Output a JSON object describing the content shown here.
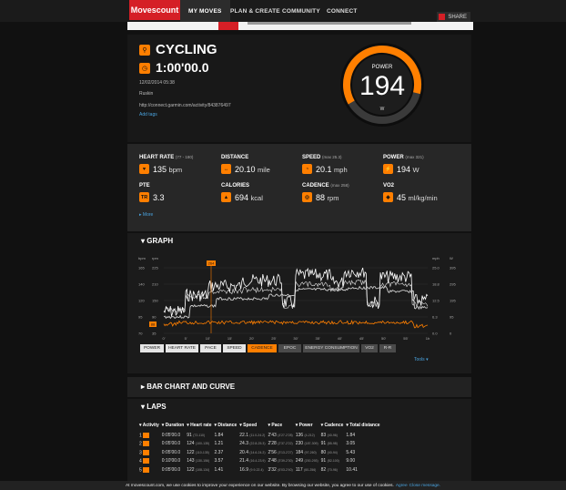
{
  "nav": {
    "logo": "Movescount",
    "items": [
      "MY MOVES",
      "PLAN & CREATE",
      "COMMUNITY",
      "CONNECT"
    ],
    "share": "SHARE"
  },
  "move": {
    "sport": "CYCLING",
    "duration": "1:00'00.0",
    "date": "12/02/2014 05:38",
    "location": "Ruskin",
    "link": "http://connect.garmin.com/activity/843876497",
    "add_tags": "Add tags"
  },
  "gauge": {
    "label": "POWER",
    "value": "194",
    "unit": "W",
    "fraction": 0.62,
    "accent": "#ff7f00"
  },
  "stats": [
    {
      "label": "HEART RATE",
      "sub": "(77 - 180)",
      "icon": "heart-icon",
      "glyph": "♥",
      "value": "135",
      "unit": "bpm"
    },
    {
      "label": "DISTANCE",
      "sub": "",
      "icon": "distance-icon",
      "glyph": "↔",
      "value": "20.10",
      "unit": "mile"
    },
    {
      "label": "SPEED",
      "sub": "(max 25.3)",
      "icon": "speed-icon",
      "glyph": "◔",
      "value": "20.1",
      "unit": "mph"
    },
    {
      "label": "POWER",
      "sub": "(max 321)",
      "icon": "power-icon",
      "glyph": "⚡",
      "value": "194",
      "unit": "W"
    },
    {
      "label": "PTE",
      "sub": "",
      "icon": "pte-icon",
      "glyph": "TR",
      "value": "3.3",
      "unit": ""
    },
    {
      "label": "CALORIES",
      "sub": "",
      "icon": "flame-icon",
      "glyph": "▲",
      "value": "694",
      "unit": "kcal"
    },
    {
      "label": "CADENCE",
      "sub": "(max 258)",
      "icon": "cadence-icon",
      "glyph": "◎",
      "value": "88",
      "unit": "rpm"
    },
    {
      "label": "VO2",
      "sub": "",
      "icon": "vo2-icon",
      "glyph": "◈",
      "value": "45",
      "unit": "ml/kg/min"
    }
  ],
  "more": "More",
  "graph": {
    "title": "GRAPH",
    "left_units": [
      "bpm",
      "rpm"
    ],
    "right_units": [
      "mph",
      "W"
    ],
    "hr_ticks": [
      "165",
      "140",
      "120",
      "95",
      "70"
    ],
    "cad_ticks": [
      "225",
      "210",
      "150",
      "90",
      "35"
    ],
    "mph_ticks": [
      "25.0",
      "18.8",
      "12.5",
      "6.3",
      "0.0"
    ],
    "w_ticks": [
      "395",
      "295",
      "195",
      "95",
      "0"
    ],
    "x_ticks": [
      "0'",
      "5'",
      "10'",
      "15'",
      "20'",
      "25'",
      "30'",
      "35'",
      "40'",
      "45'",
      "50'",
      "55'",
      "1h"
    ],
    "marker_label": "264",
    "left_badge": "88",
    "chips": [
      "POWER",
      "HEART RATE",
      "PACE",
      "SPEED",
      "CADENCE",
      "EPOC",
      "ENERGY CONSUMPTION",
      "VO2",
      "R-R"
    ],
    "tools": "Tools"
  },
  "bar_chart_title": "BAR CHART AND CURVE",
  "laps": {
    "title": "LAPS",
    "headers": [
      "Activity",
      "Duration",
      "Heart rate",
      "Distance",
      "Speed",
      "Pace",
      "Power",
      "Cadence",
      "Total distance"
    ],
    "rows": [
      {
        "n": "1",
        "duration": "0:05'00.0",
        "hr": "91",
        "hr_r": "(72-110)",
        "dist": "1.84",
        "spd": "22.1",
        "spd_r": "(11.0-24.2)",
        "pace": "2'43",
        "pace_r": "(4'27-2'28)",
        "pwr": "136",
        "pwr_r": "(4-212)",
        "cad": "83",
        "cad_r": "(40-96)",
        "total": "1.84"
      },
      {
        "n": "2",
        "duration": "0:05'00.0",
        "hr": "124",
        "hr_r": "(100-135)",
        "dist": "1.21",
        "spd": "24.3",
        "spd_r": "(22.8-25.3)",
        "pace": "2'28",
        "pace_r": "(2'37-2'22)",
        "pwr": "230",
        "pwr_r": "(187-309)",
        "cad": "91",
        "cad_r": "(85-98)",
        "total": "3.05"
      },
      {
        "n": "3",
        "duration": "0:05'00.0",
        "hr": "122",
        "hr_r": "(110-135)",
        "dist": "2.37",
        "spd": "20.4",
        "spd_r": "(14.6-24.2)",
        "pace": "2'56",
        "pace_r": "(3'13-2'27)",
        "pwr": "184",
        "pwr_r": "(97-260)",
        "cad": "80",
        "cad_r": "(40-94)",
        "total": "5.43"
      },
      {
        "n": "4",
        "duration": "0:10'00.0",
        "hr": "143",
        "hr_r": "(130-156)",
        "dist": "3.57",
        "spd": "21.4",
        "spd_r": "(16.4-23.9)",
        "pace": "2'48",
        "pace_r": "(3'39-2'30)",
        "pwr": "249",
        "pwr_r": "(200-293)",
        "cad": "91",
        "cad_r": "(82-100)",
        "total": "9.00"
      },
      {
        "n": "5",
        "duration": "0:05'00.0",
        "hr": "122",
        "hr_r": "(108-134)",
        "dist": "1.41",
        "spd": "16.9",
        "spd_r": "(9.9-22.4)",
        "pace": "3'32",
        "pace_r": "(6'03-2'40)",
        "pwr": "117",
        "pwr_r": "(60-256)",
        "cad": "82",
        "cad_r": "(70-96)",
        "total": "10.41"
      }
    ]
  },
  "cookie": {
    "text": "At movescount.com, we use cookies to improve your experience on our website. By browsing our website, you agree to our use of cookies.",
    "agree": "Agree",
    "close": "Close message."
  }
}
